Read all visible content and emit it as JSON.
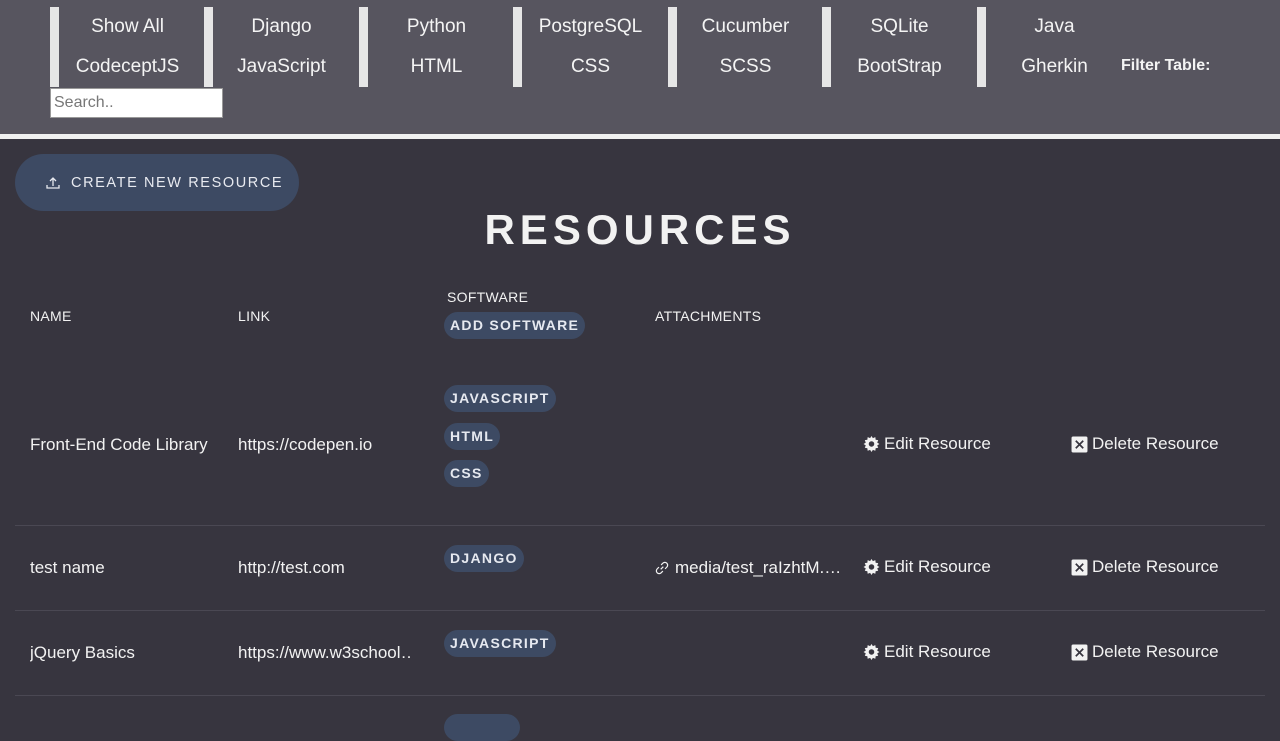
{
  "filters": {
    "top_row": [
      "Show All",
      "Django",
      "Python",
      "PostgreSQL",
      "Cucumber",
      "SQLite",
      "Java"
    ],
    "bottom_row": [
      "CodeceptJS",
      "JavaScript",
      "HTML",
      "CSS",
      "SCSS",
      "BootStrap",
      "Gherkin"
    ],
    "filter_label": "Filter Table:",
    "search_placeholder": "Search.."
  },
  "create_button_label": "CREATE NEW RESOURCE",
  "page_title": "RESOURCES",
  "table": {
    "headers": {
      "name": "NAME",
      "link": "LINK",
      "software": "SOFTWARE",
      "add_software": "ADD SOFTWARE",
      "attachments": "ATTACHMENTS"
    },
    "edit_label": "Edit Resource",
    "delete_label": "Delete Resource",
    "rows": [
      {
        "name": "Front-End Code Library",
        "link": "https://codepen.io",
        "software": [
          "JAVASCRIPT",
          "HTML",
          "CSS"
        ],
        "attachment": ""
      },
      {
        "name": "test name",
        "link": "http://test.com",
        "software": [
          "DJANGO"
        ],
        "attachment": "media/test_raIzhtM.…"
      },
      {
        "name": "jQuery Basics",
        "link": "https://www.w3school…",
        "software": [
          "JAVASCRIPT"
        ],
        "attachment": ""
      }
    ]
  },
  "colors": {
    "page_bg": "#37353f",
    "topbar_bg": "#57555f",
    "pill_bg": "#3d4a63"
  }
}
